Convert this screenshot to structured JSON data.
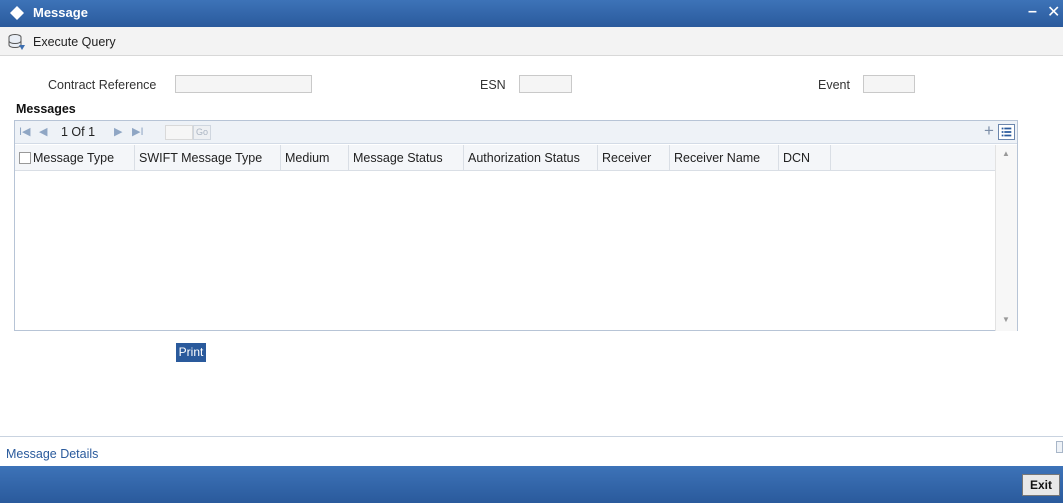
{
  "window": {
    "title": "Message",
    "minimize_glyph": "–",
    "close_glyph": "✕",
    "icon": "diamond-icon"
  },
  "toolbar": {
    "execute_query_label": "Execute Query",
    "icon": "database-icon"
  },
  "filters": {
    "contract_reference_label": "Contract Reference",
    "contract_reference_value": "",
    "esn_label": "ESN",
    "esn_value": "",
    "event_label": "Event",
    "event_value": ""
  },
  "messages": {
    "section_title": "Messages",
    "pager": {
      "first_glyph": "I◀",
      "prev_glyph": "◀",
      "page_info": "1 Of 1",
      "next_glyph": "▶",
      "last_glyph": "▶I",
      "page_input_value": "",
      "go_label": "Go",
      "add_glyph": "+"
    },
    "columns": [
      "Message Type",
      "SWIFT Message Type",
      "Medium",
      "Message Status",
      "Authorization Status",
      "Receiver",
      "Receiver Name",
      "DCN"
    ],
    "rows": []
  },
  "actions": {
    "print_label": "Print",
    "message_details_label": "Message Details",
    "exit_label": "Exit"
  },
  "colors": {
    "title_bar": "#2a5a9c",
    "accent": "#2a5a9c"
  }
}
